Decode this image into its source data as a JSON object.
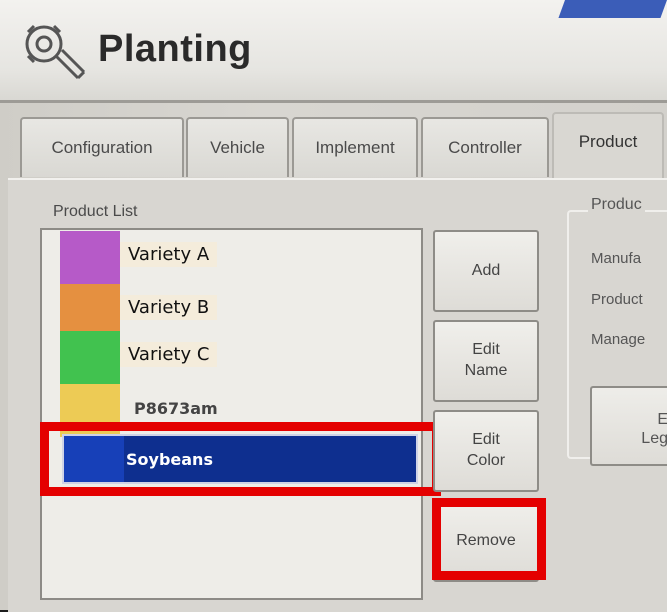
{
  "header": {
    "title": "Planting",
    "logo_icon": "wrench-gear-icon"
  },
  "tabs": [
    {
      "label": "Configuration"
    },
    {
      "label": "Vehicle"
    },
    {
      "label": "Implement"
    },
    {
      "label": "Controller"
    },
    {
      "label": "Product",
      "active": true
    }
  ],
  "product_list": {
    "label": "Product List",
    "items": [
      {
        "name": "Variety A",
        "color": "#b65ac8"
      },
      {
        "name": "Variety B",
        "color": "#e59040"
      },
      {
        "name": "Variety C",
        "color": "#41c24f"
      },
      {
        "name": "P8673am",
        "color": "#edcb55"
      },
      {
        "name": "Soybeans",
        "color": "#1740b8",
        "selected": true
      }
    ]
  },
  "buttons": {
    "add": "Add",
    "edit_name": "Edit\nName",
    "edit_color": "Edit\nColor",
    "remove": "Remove"
  },
  "product_group": {
    "title": "Produc",
    "manufacturer_label": "Manufa",
    "product_label": "Product",
    "manager_label": "Manage",
    "legend_button": "E\nLeg"
  },
  "highlight_color": "#e40000"
}
